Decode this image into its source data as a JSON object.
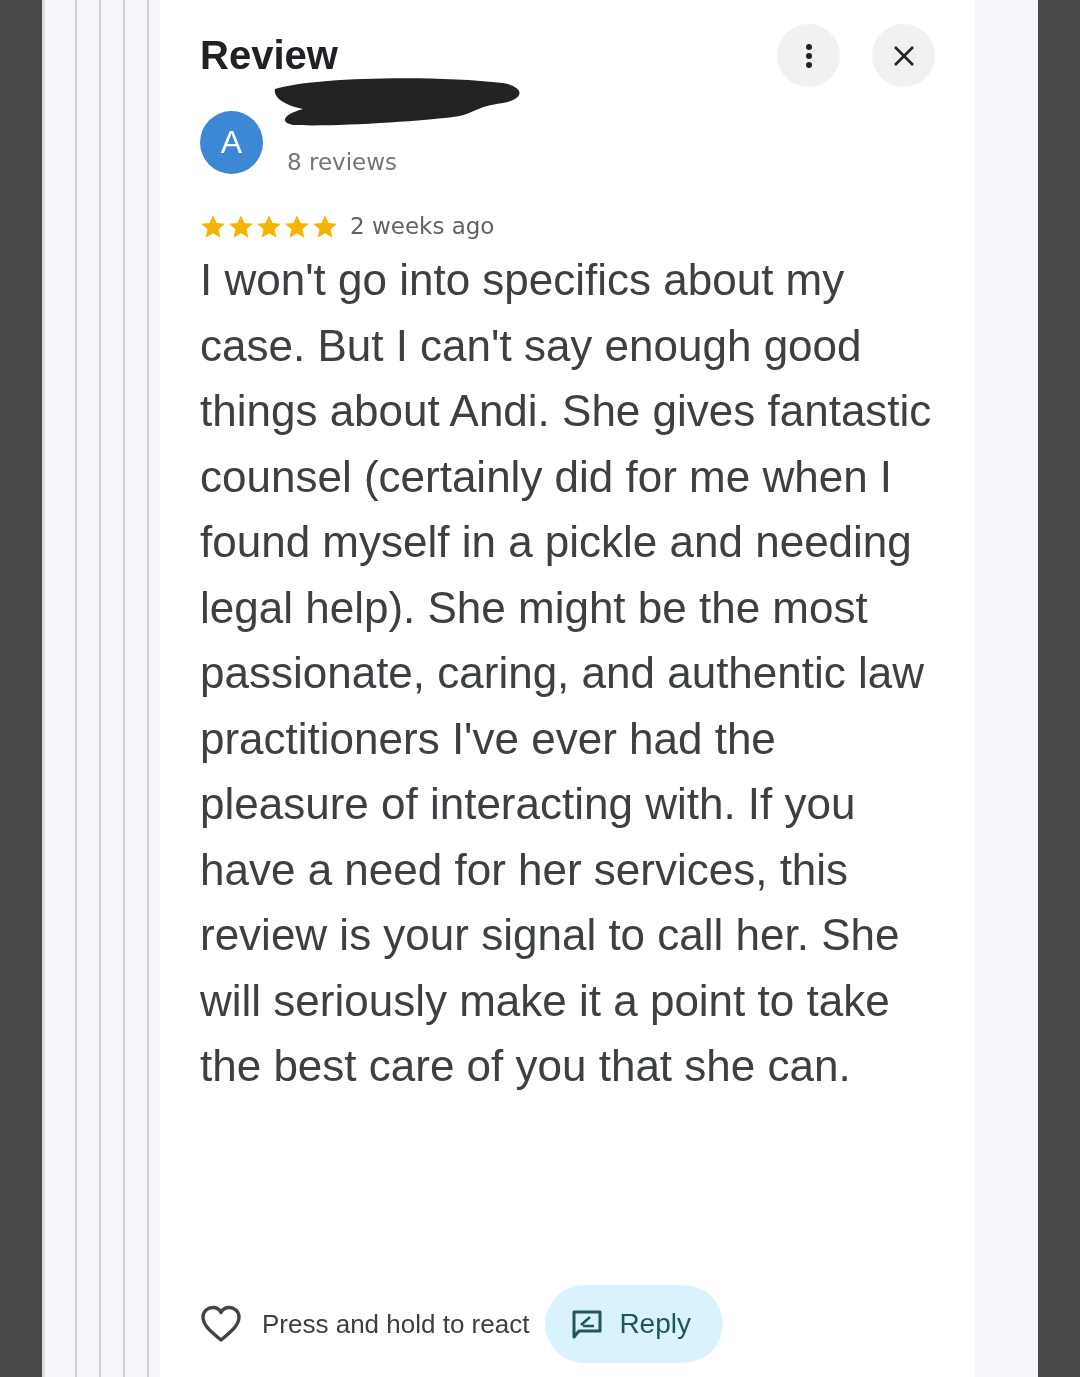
{
  "header": {
    "title": "Review"
  },
  "reviewer": {
    "avatar_letter": "A",
    "name_redacted": true,
    "review_count": "8 reviews"
  },
  "review": {
    "stars": 5,
    "time": "2 weeks ago",
    "text": "I won't go into specifics about my case. But I can't say enough good things about Andi. She gives fantastic counsel (certainly did for me when I found myself in a pickle and needing legal help). She might be the most passionate, caring, and authentic law practitioners I've ever had the pleasure of interacting with. If you have a need for her services, this review is your signal to call her. She will seriously make it a point to take the best care of you that she can."
  },
  "actions": {
    "react_label": "Press and hold to react",
    "reply_label": "Reply"
  }
}
